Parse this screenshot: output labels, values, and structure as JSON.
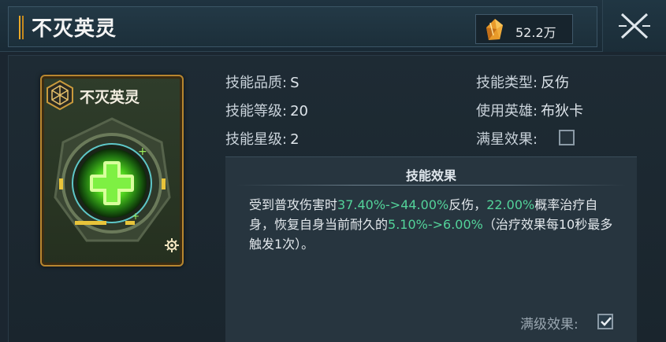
{
  "header": {
    "title": "不灭英灵",
    "currency_value": "52.2万",
    "currency_icon": "crystal-icon",
    "close_icon": "close-icon"
  },
  "card": {
    "name": "不灭英灵",
    "badge_icon": "shield-emblem-icon",
    "art_icon": "green-cross-heal-icon",
    "gear_icon": "gear-icon"
  },
  "stats": {
    "quality_label": "技能品质:",
    "quality_value": "S",
    "level_label": "技能等级:",
    "level_value": "20",
    "star_label": "技能星级:",
    "star_value": "2",
    "type_label": "技能类型:",
    "type_value": "反伤",
    "hero_label": "使用英雄:",
    "hero_value": "布狄卡",
    "fullstar_label": "满星效果:",
    "fullstar_checked": false
  },
  "effect": {
    "title": "技能效果",
    "seg1": "受到普攻伤害时",
    "hl1": "37.40%->44.00%",
    "seg2": "反伤，",
    "hl2": "22.00%",
    "seg3": "概率治疗自身，恢复自身当前耐久的",
    "hl3": "5.10%->6.00%",
    "seg4": "（治疗效果每10秒最多触发1次）。"
  },
  "maxlevel": {
    "label": "满级效果:",
    "checked": true
  },
  "colors": {
    "highlight": "#53d39a",
    "card_border": "#b8862f",
    "accent": "#e9a92a"
  }
}
